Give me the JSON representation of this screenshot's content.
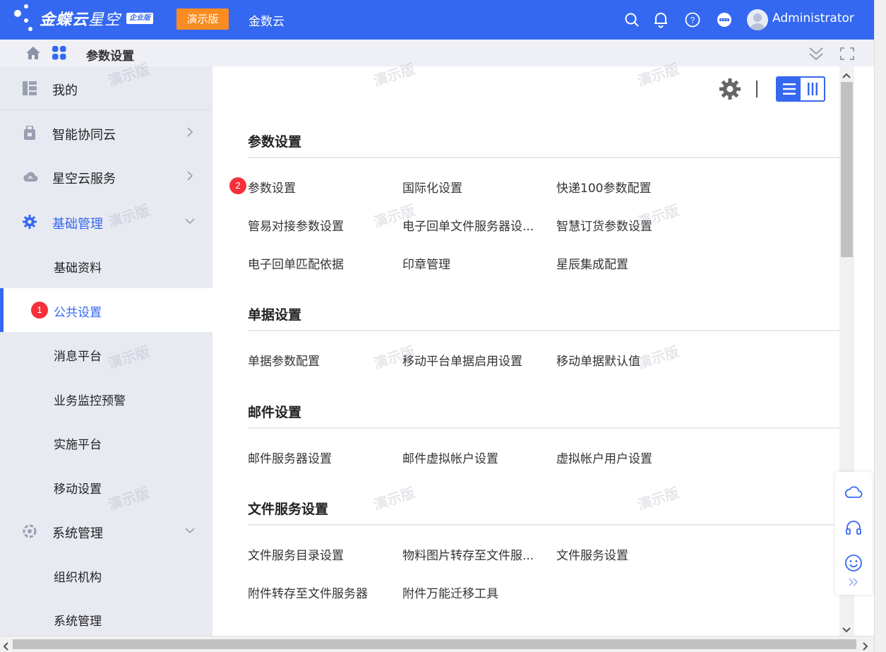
{
  "topbar": {
    "brand": "金蝶云",
    "brand_sub": "星空",
    "edition": "企业版",
    "demo_label": "演示版",
    "link": "金数云",
    "user_name": "Administrator",
    "bg_color": "#3568f0",
    "demo_color": "#fb8c21",
    "icons": [
      "search-icon",
      "bell-icon",
      "help-icon",
      "more-icon"
    ]
  },
  "breadcrumb": {
    "title": "参数设置",
    "icons": [
      "home-icon",
      "apps-icon",
      "collapse-icon",
      "fullscreen-icon"
    ]
  },
  "sidebar": {
    "items": [
      {
        "label": "我的",
        "icon": "dashboard-icon"
      },
      {
        "label": "智能协同云",
        "icon": "bag-icon"
      },
      {
        "label": "星空云服务",
        "icon": "cloud-icon"
      },
      {
        "label": "基础管理",
        "icon": "gear-icon"
      },
      {
        "label": "基础资料"
      },
      {
        "label": "公共设置",
        "marker": "1"
      },
      {
        "label": "消息平台"
      },
      {
        "label": "业务监控预警"
      },
      {
        "label": "实施平台"
      },
      {
        "label": "移动设置"
      },
      {
        "label": "系统管理",
        "icon": "settings-icon"
      },
      {
        "label": "组织机构"
      },
      {
        "label": "系统管理"
      }
    ]
  },
  "sections": [
    {
      "title": "参数设置",
      "links": [
        "参数设置",
        "国际化设置",
        "快递100参数配置",
        "管易对接参数设置",
        "电子回单文件服务器设...",
        "智慧订货参数设置",
        "电子回单匹配依据",
        "印章管理",
        "星辰集成配置"
      ]
    },
    {
      "title": "单据设置",
      "links": [
        "单据参数配置",
        "移动平台单据启用设置",
        "移动单据默认值"
      ]
    },
    {
      "title": "邮件设置",
      "links": [
        "邮件服务器设置",
        "邮件虚拟帐户设置",
        "虚拟帐户用户设置"
      ]
    },
    {
      "title": "文件服务设置",
      "links": [
        "文件服务目录设置",
        "物料图片转存至文件服...",
        "文件服务设置",
        "附件转存至文件服务器",
        "附件万能迁移工具"
      ]
    }
  ],
  "markers": {
    "link_marker": "2"
  },
  "watermark": "演示版",
  "accent_color": "#3568f0",
  "marker_color": "#f5303a"
}
